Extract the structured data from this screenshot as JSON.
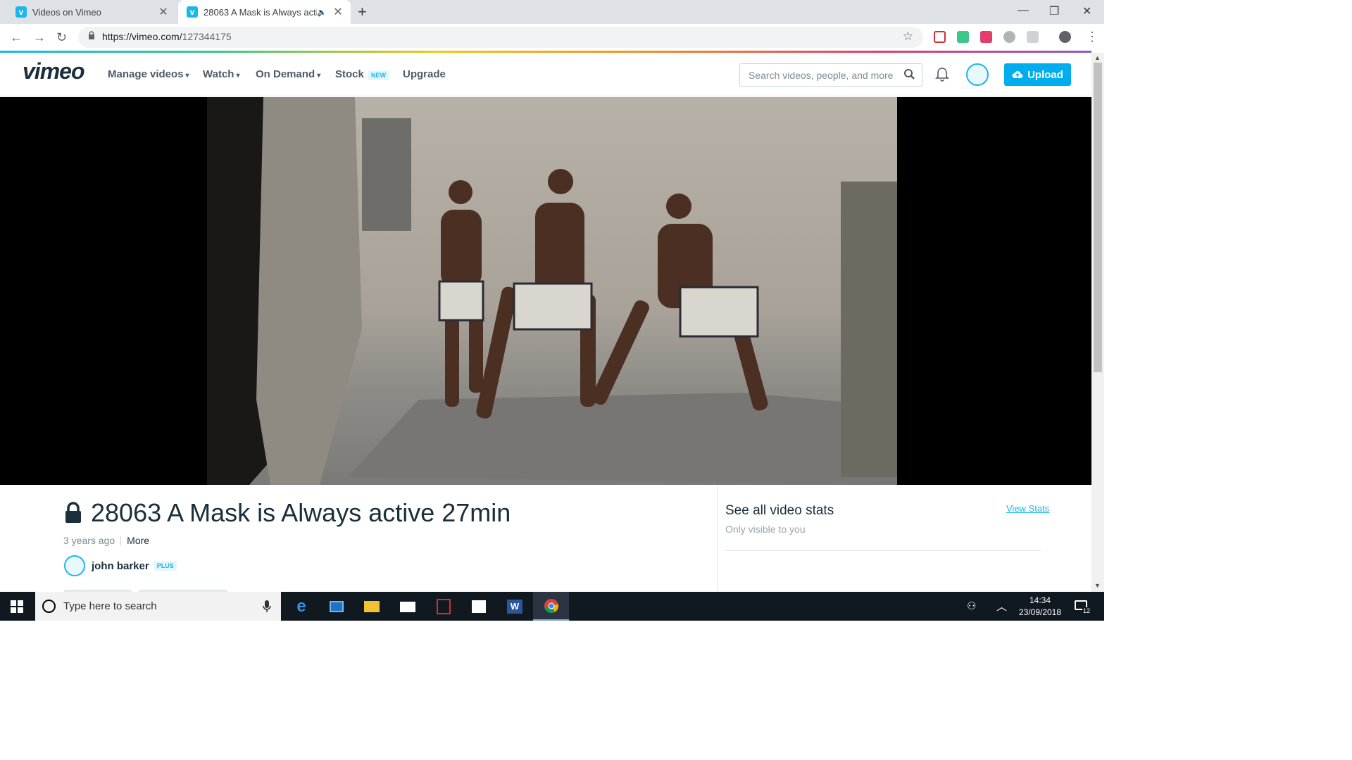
{
  "browser": {
    "tabs": [
      {
        "title": "Videos on Vimeo",
        "active": false
      },
      {
        "title": "28063 A Mask is Always active 27min",
        "active": true
      }
    ],
    "url_host": "https://vimeo.com/",
    "url_path": "127344175"
  },
  "header": {
    "logo": "vimeo",
    "nav": [
      "Manage videos",
      "Watch",
      "On Demand",
      "Stock",
      "Upgrade"
    ],
    "stock_badge": "NEW",
    "search_placeholder": "Search videos, people, and more",
    "upload_label": "Upload"
  },
  "video": {
    "title": "28063 A Mask is Always active 27min",
    "posted": "3 years ago",
    "more_label": "More",
    "owner": "john barker",
    "owner_badge": "PLUS"
  },
  "stats_panel": {
    "title": "See all video stats",
    "subtitle": "Only visible to you",
    "link": "View Stats"
  },
  "taskbar": {
    "search_placeholder": "Type here to search",
    "time": "14:34",
    "date": "23/09/2018",
    "notifications": "12"
  },
  "colors": {
    "vimeo_blue": "#1ab7ea",
    "upload_button": "#00adef",
    "text_dark": "#1a2e3b",
    "taskbar": "#101820"
  }
}
